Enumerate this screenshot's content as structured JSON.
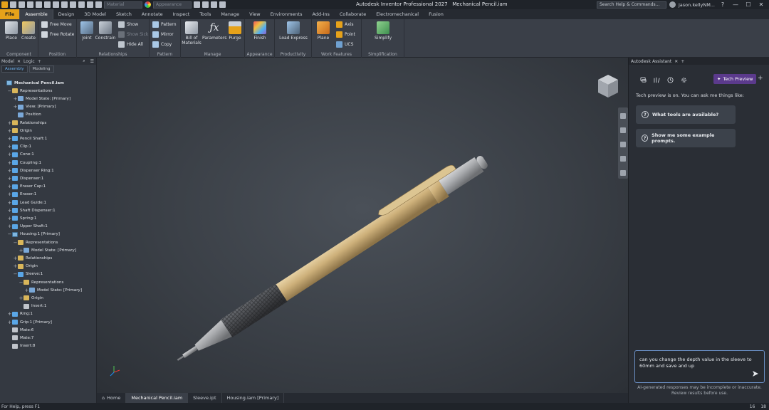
{
  "app": {
    "title": "Autodesk Inventor Professional 2027",
    "document": "Mechanical Pencil.iam",
    "material_placeholder": "Material",
    "appearance_placeholder": "Appearance",
    "search": "Search Help & Commands...",
    "user": "jason.kellyNM...",
    "accent": "#e6a21a"
  },
  "ribbon_tabs": [
    "File",
    "Assemble",
    "Design",
    "3D Model",
    "Sketch",
    "Annotate",
    "Inspect",
    "Tools",
    "Manage",
    "View",
    "Environments",
    "Add-Ins",
    "Collaborate",
    "Electromechanical",
    "Fusion"
  ],
  "ribbon": {
    "component": {
      "label": "Component",
      "place": "Place",
      "create": "Create"
    },
    "position": {
      "label": "Position",
      "free_move": "Free Move",
      "free_rotate": "Free Rotate"
    },
    "relationships": {
      "label": "Relationships",
      "joint": "Joint",
      "constrain": "Constrain",
      "show": "Show",
      "show_sick": "Show Sick",
      "hide_all": "Hide All"
    },
    "pattern": {
      "label": "Pattern",
      "pattern": "Pattern",
      "mirror": "Mirror",
      "copy": "Copy"
    },
    "manage": {
      "label": "Manage",
      "bom_line1": "Bill of",
      "bom_line2": "Materials",
      "parameters": "Parameters",
      "purge": "Purge"
    },
    "appearance": {
      "label": "Appearance",
      "finish": "Finish"
    },
    "productivity": {
      "label": "Productivity",
      "load_express": "Load Express"
    },
    "work_features": {
      "label": "Work Features",
      "plane": "Plane",
      "axis": "Axis",
      "point": "Point",
      "ucs": "UCS"
    },
    "simplification": {
      "label": "Simplification",
      "simplify": "Simplify"
    }
  },
  "browser": {
    "header_model": "Model",
    "header_logic": "Logic",
    "tab_assembly": "Assembly",
    "tab_modeling": "Modeling",
    "tree": [
      {
        "label": "Mechanical Pencil.iam",
        "indent": 0,
        "icon": "asm",
        "exp": ""
      },
      {
        "label": "Representations",
        "indent": 1,
        "icon": "folder",
        "exp": "−"
      },
      {
        "label": "Model State: [Primary]",
        "indent": 2,
        "icon": "blue",
        "exp": "+"
      },
      {
        "label": "View: [Primary]",
        "indent": 2,
        "icon": "blue",
        "exp": "+"
      },
      {
        "label": "Position",
        "indent": 2,
        "icon": "blue",
        "exp": ""
      },
      {
        "label": "Relationships",
        "indent": 1,
        "icon": "folder",
        "exp": "+"
      },
      {
        "label": "Origin",
        "indent": 1,
        "icon": "folder",
        "exp": "+"
      },
      {
        "label": "Pencil Shaft:1",
        "indent": 1,
        "icon": "part",
        "exp": "+"
      },
      {
        "label": "Clip:1",
        "indent": 1,
        "icon": "part",
        "exp": "+"
      },
      {
        "label": "Cone:1",
        "indent": 1,
        "icon": "part",
        "exp": "+"
      },
      {
        "label": "Coupling:1",
        "indent": 1,
        "icon": "part",
        "exp": "+"
      },
      {
        "label": "Dispenser Ring:1",
        "indent": 1,
        "icon": "part",
        "exp": "+"
      },
      {
        "label": "Dispenser:1",
        "indent": 1,
        "icon": "part",
        "exp": "+"
      },
      {
        "label": "Eraser Cap:1",
        "indent": 1,
        "icon": "part",
        "exp": "+"
      },
      {
        "label": "Eraser:1",
        "indent": 1,
        "icon": "part",
        "exp": "+"
      },
      {
        "label": "Lead Guide:1",
        "indent": 1,
        "icon": "part",
        "exp": "+"
      },
      {
        "label": "Shaft Dispenser:1",
        "indent": 1,
        "icon": "part",
        "exp": "+"
      },
      {
        "label": "Spring:1",
        "indent": 1,
        "icon": "part",
        "exp": "+"
      },
      {
        "label": "Upper Shaft:1",
        "indent": 1,
        "icon": "part",
        "exp": "+"
      },
      {
        "label": "Housing:1 [Primary]",
        "indent": 1,
        "icon": "asm",
        "exp": "−"
      },
      {
        "label": "Representations",
        "indent": 2,
        "icon": "folder",
        "exp": "−"
      },
      {
        "label": "Model State: [Primary]",
        "indent": 3,
        "icon": "blue",
        "exp": "+"
      },
      {
        "label": "Relationships",
        "indent": 2,
        "icon": "folder",
        "exp": "+"
      },
      {
        "label": "Origin",
        "indent": 2,
        "icon": "folder",
        "exp": "+"
      },
      {
        "label": "Sleeve:1",
        "indent": 2,
        "icon": "part",
        "exp": "−"
      },
      {
        "label": "Representations",
        "indent": 3,
        "icon": "folder",
        "exp": "−"
      },
      {
        "label": "Model State: [Primary]",
        "indent": 4,
        "icon": "blue",
        "exp": "+"
      },
      {
        "label": "Origin",
        "indent": 3,
        "icon": "folder",
        "exp": "+"
      },
      {
        "label": "Insert:1",
        "indent": 3,
        "icon": "mate",
        "exp": ""
      },
      {
        "label": "Ring:1",
        "indent": 1,
        "icon": "part",
        "exp": "+"
      },
      {
        "label": "Grip:1 [Primary]",
        "indent": 1,
        "icon": "part",
        "exp": "+"
      },
      {
        "label": "Mate:6",
        "indent": 1,
        "icon": "mate",
        "exp": ""
      },
      {
        "label": "Mate:7",
        "indent": 1,
        "icon": "mate",
        "exp": ""
      },
      {
        "label": "Insert:8",
        "indent": 1,
        "icon": "mate",
        "exp": ""
      }
    ]
  },
  "doc_tabs": {
    "home": "Home",
    "tabs": [
      "Mechanical Pencil.iam",
      "Sleeve.ipt",
      "Housing.iam [Primary]"
    ]
  },
  "assistant": {
    "header": "Autodesk Assistant",
    "tech_preview": "Tech Preview",
    "intro": "Tech preview is on. You can ask me things like:",
    "prompts": [
      "What tools are available?",
      "Show me some example prompts."
    ],
    "input_value": "can you change the depth value in the sleeve to 60mm and save and up",
    "disclaimer_line1": "AI-generated responses may be incomplete or inaccurate.",
    "disclaimer_line2": "Review results before use.",
    "accent": "#5b3a8c"
  },
  "status": {
    "help_text": "For Help, press F1",
    "count1": "16",
    "count2": "18"
  }
}
